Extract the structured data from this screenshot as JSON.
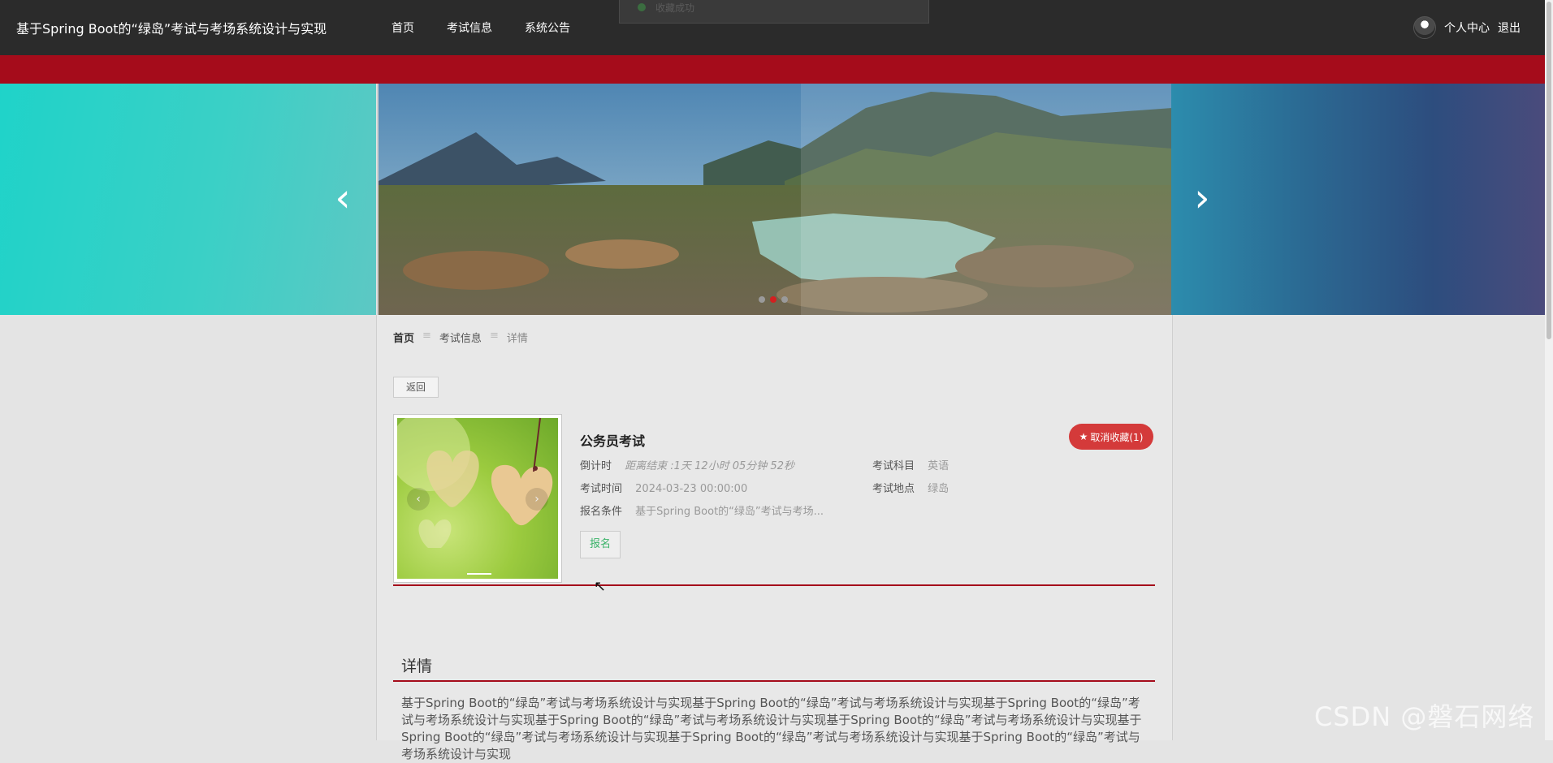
{
  "header": {
    "site_title": "基于Spring Boot的“绿岛”考试与考场系统设计与实现",
    "nav": [
      "首页",
      "考试信息",
      "系统公告"
    ],
    "user_center": "个人中心",
    "logout": "退出",
    "toast_text": "收藏成功"
  },
  "breadcrumb": {
    "home": "首页",
    "section": "考试信息",
    "current": "详情",
    "sep": "≡"
  },
  "back_button": "返回",
  "exam": {
    "title": "公务员考试",
    "favorite_label": "取消收藏(1)",
    "countdown_label": "倒计时",
    "countdown_value": "距离结束 :1天 12小时 05分钟 52秒",
    "subject_label": "考试科目",
    "subject_value": "英语",
    "time_label": "考试时间",
    "time_value": "2024-03-23 00:00:00",
    "location_label": "考试地点",
    "location_value": "绿岛",
    "requirement_label": "报名条件",
    "requirement_value": "基于Spring Boot的“绿岛”考试与考场...",
    "signup_button": "报名"
  },
  "detail": {
    "title": "详情",
    "text": "基于Spring Boot的“绿岛”考试与考场系统设计与实现基于Spring Boot的“绿岛”考试与考场系统设计与实现基于Spring Boot的“绿岛”考试与考场系统设计与实现基于Spring Boot的“绿岛”考试与考场系统设计与实现基于Spring Boot的“绿岛”考试与考场系统设计与实现基于Spring Boot的“绿岛”考试与考场系统设计与实现基于Spring Boot的“绿岛”考试与考场系统设计与实现基于Spring Boot的“绿岛”考试与考场系统设计与实现"
  },
  "watermark": "CSDN @磐石网络",
  "colors": {
    "header_bg": "#2b2b2b",
    "accent_red": "#a50c1b",
    "favorite_red": "#d43a3a",
    "signup_green": "#3cb36a"
  },
  "icons": [
    "chevron-left-icon",
    "chevron-right-icon",
    "star-icon",
    "avatar-icon",
    "mouse-cursor-icon"
  ]
}
